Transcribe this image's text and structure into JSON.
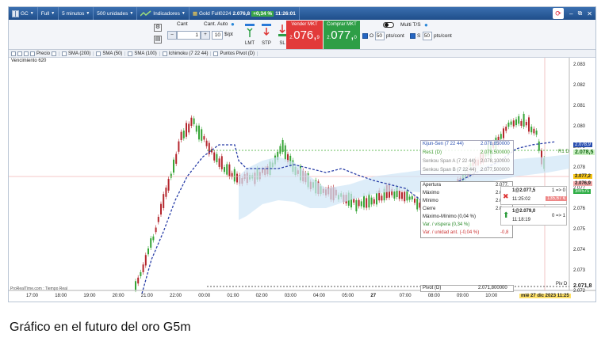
{
  "toolbar": {
    "symbol": "GC",
    "size": "Full",
    "timeframe": "5 minutos",
    "units": "500 unidades",
    "indicators_label": "Indicadores",
    "contract": "Gold Full0224",
    "last_price": "2.076,8",
    "change": "+0,34 %",
    "time": "11:26:01"
  },
  "order": {
    "cant_label": "Cant",
    "cant_auto_label": "Cant. Auto",
    "qty_value": "1",
    "pts_value": "10",
    "pts_unit": "$/pt",
    "lmt": "LMT",
    "stp": "STP",
    "sl": "SL",
    "sell_label": "Vender MKT",
    "sell_prefix": "2.",
    "sell_big": "076,",
    "sell_sup": "9",
    "buy_label": "Comprar MKT",
    "buy_prefix": "2.",
    "buy_big": "077,",
    "buy_sup": "0",
    "multi": "Multi T/S",
    "o_label": "O",
    "o_value": "50",
    "o_unit": "pts/cont",
    "s_label": "S",
    "s_value": "50",
    "s_unit": "pts/cont"
  },
  "indicator_bar": [
    "Precio",
    "SMA (200)",
    "SMA (50)",
    "SMA (100)",
    "Ichimoku (7 22 44)",
    "Puntos Pivot (D)"
  ],
  "chart": {
    "vencimiento": "Vencimiento 620",
    "source": "ProRealTime.com : Tiempo Real",
    "y_ticks": [
      "2.083",
      "2.082",
      "2.081",
      "2.080",
      "2.079",
      "2.078",
      "2.077",
      "2.076",
      "2.075",
      "2.074",
      "2.073",
      "2.072"
    ],
    "x_ticks": [
      "17:00",
      "18:00",
      "19:00",
      "20:00",
      "21:00",
      "22:00",
      "00:00",
      "01:00",
      "02:00",
      "03:00",
      "04:00",
      "05:00",
      "27",
      "07:00",
      "08:00",
      "09:00",
      "10:00"
    ],
    "date_badge": "mié 27 dic 2023 11:25",
    "price_tags": {
      "kijun": "2.078,9",
      "r1": "2.078,5",
      "last": "2.077,2",
      "bid": "2.076,9",
      "timer": "3m57s",
      "pivot": "2.071,8"
    },
    "r1_tag": "R1 D",
    "pivot_tag": "Piv D",
    "legend": [
      {
        "name": "Kijun-Sen (7 22 44)",
        "value": "2.078,850000"
      },
      {
        "name": "Res1 (D)",
        "value": "2.078,500000"
      },
      {
        "name": "Senkou Span A (7 22 44)",
        "value": "2.078,100000"
      },
      {
        "name": "Senkou Span B (7 22 44)",
        "value": "2.077,500000"
      }
    ],
    "pivot_box": {
      "name": "Pivot (D)",
      "value": "2.071,800000"
    },
    "info": [
      {
        "k": "Apertura",
        "v": "2.077,"
      },
      {
        "k": "Máximo",
        "v": "2.0"
      },
      {
        "k": "Mínimo",
        "v": "2.0"
      },
      {
        "k": "Cierre",
        "v": "2.0"
      },
      {
        "k": "Máximo-Mínimo (0,04 %)",
        "v": ""
      },
      {
        "k": "Var. / víspera (0,34 %)",
        "v": ""
      },
      {
        "k": "Var. / unidad ant. (-0,04 %)",
        "v": "-0,8"
      }
    ],
    "pos_sell": {
      "price": "1@2.077,5",
      "time": "11:25:02",
      "ratio": "1 => 0",
      "pnl": "135,67 €"
    },
    "pos_buy": {
      "price": "1@2.079,0",
      "time": "11:18:19",
      "ratio": "0 => 1"
    }
  },
  "caption": "Gráfico en el futuro del oro G5m"
}
